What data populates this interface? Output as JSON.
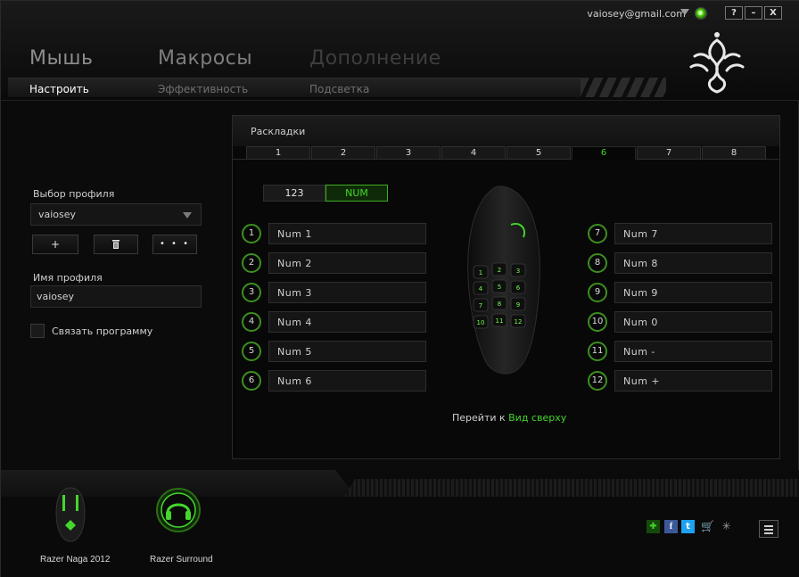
{
  "window": {
    "account_email": "vaiosey@gmail.com",
    "help_label": "?",
    "minimize_label": "–",
    "close_label": "X"
  },
  "nav": {
    "main_tabs": [
      "Мышь",
      "Макросы",
      "Дополнение"
    ],
    "sub_tabs": [
      "Настроить",
      "Эффективность",
      "Подсветка"
    ],
    "active_main": "Мышь",
    "active_sub": "Настроить"
  },
  "profile": {
    "select_label": "Выбор профиля",
    "selected": "vaiosey",
    "add_label": "+",
    "delete_label": "🗑",
    "more_label": "• • •",
    "name_label": "Имя профиля",
    "name_value": "vaiosey",
    "link_program_label": "Связать программу",
    "link_program_checked": false
  },
  "keymaps": {
    "title": "Раскладки",
    "tabs": [
      "1",
      "2",
      "3",
      "4",
      "5",
      "6",
      "7",
      "8"
    ],
    "active_tab": "6",
    "modes": [
      "123",
      "NUM"
    ],
    "active_mode": "NUM",
    "left_keys": [
      {
        "num": "1",
        "value": "Num 1"
      },
      {
        "num": "2",
        "value": "Num 2"
      },
      {
        "num": "3",
        "value": "Num 3"
      },
      {
        "num": "4",
        "value": "Num 4"
      },
      {
        "num": "5",
        "value": "Num 5"
      },
      {
        "num": "6",
        "value": "Num 6"
      }
    ],
    "right_keys": [
      {
        "num": "7",
        "value": "Num 7"
      },
      {
        "num": "8",
        "value": "Num 8"
      },
      {
        "num": "9",
        "value": "Num 9"
      },
      {
        "num": "10",
        "value": "Num 0"
      },
      {
        "num": "11",
        "value": "Num -"
      },
      {
        "num": "12",
        "value": "Num +"
      }
    ],
    "mouse_grid_labels": [
      "1",
      "2",
      "3",
      "4",
      "5",
      "6",
      "7",
      "8",
      "9",
      "10",
      "11",
      "12"
    ],
    "goto_prefix": "Перейти к",
    "goto_link": "Вид сверху"
  },
  "devices": [
    {
      "name": "Razer Naga 2012",
      "icon": "mouse-icon"
    },
    {
      "name": "Razer Surround",
      "icon": "headphones-icon"
    }
  ],
  "footer_icons": [
    "gift-icon",
    "facebook-icon",
    "twitter-icon",
    "cart-icon",
    "razer-icon",
    "menu-icon"
  ],
  "colors": {
    "accent": "#44d62c",
    "background": "#0b0b0b",
    "panel": "#080808"
  }
}
